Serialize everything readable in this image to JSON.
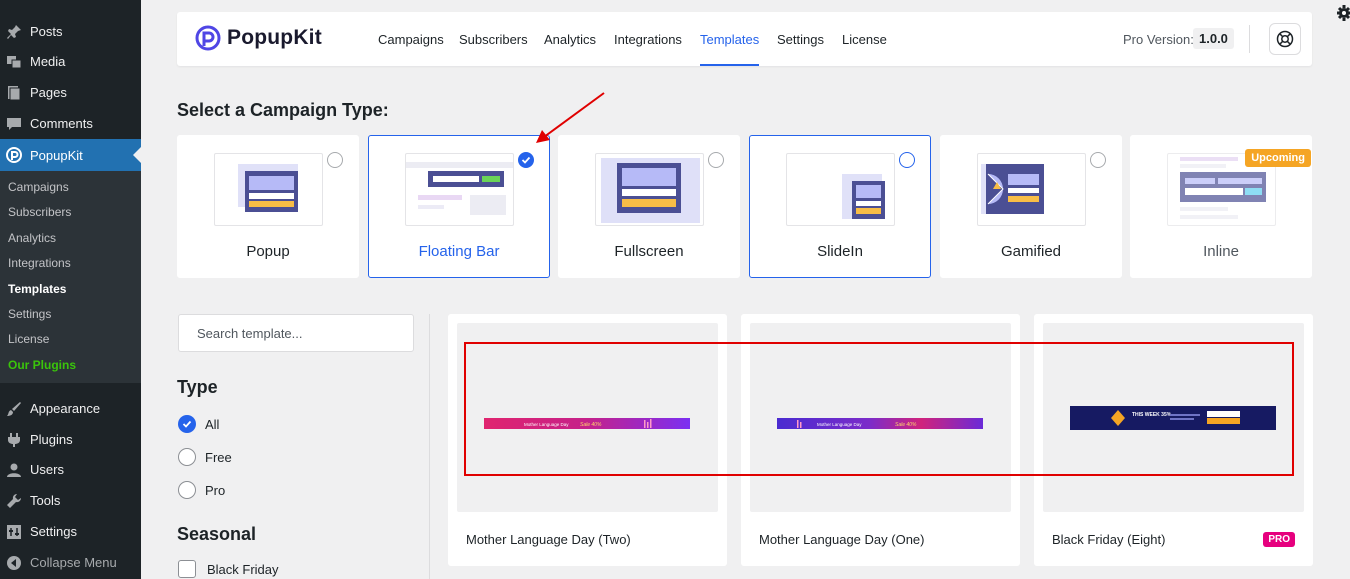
{
  "sidebar": {
    "items": [
      {
        "label": "Posts",
        "icon": "pin-icon"
      },
      {
        "label": "Media",
        "icon": "media-icon"
      },
      {
        "label": "Pages",
        "icon": "pages-icon"
      },
      {
        "label": "Comments",
        "icon": "comments-icon"
      },
      {
        "label": "PopupKit",
        "icon": "popupkit-icon"
      }
    ],
    "submenu": [
      "Campaigns",
      "Subscribers",
      "Analytics",
      "Integrations",
      "Templates",
      "Settings",
      "License",
      "Our Plugins"
    ],
    "items_bottom": [
      {
        "label": "Appearance",
        "icon": "brush-icon"
      },
      {
        "label": "Plugins",
        "icon": "plugin-icon"
      },
      {
        "label": "Users",
        "icon": "user-icon"
      },
      {
        "label": "Tools",
        "icon": "wrench-icon"
      },
      {
        "label": "Settings",
        "icon": "settings-icon"
      },
      {
        "label": "Collapse Menu",
        "icon": "collapse-icon"
      }
    ]
  },
  "header": {
    "brand": "PopupKit",
    "nav": [
      "Campaigns",
      "Subscribers",
      "Analytics",
      "Integrations",
      "Templates",
      "Settings",
      "License"
    ],
    "active_nav": "Templates",
    "pro_label": "Pro Version:",
    "pro_version": "1.0.0"
  },
  "campaign": {
    "title": "Select a Campaign Type:",
    "types": [
      {
        "label": "Popup",
        "state": "unselected"
      },
      {
        "label": "Floating Bar",
        "state": "selected"
      },
      {
        "label": "Fullscreen",
        "state": "unselected"
      },
      {
        "label": "SlideIn",
        "state": "outlined"
      },
      {
        "label": "Gamified",
        "state": "unselected"
      },
      {
        "label": "Inline",
        "state": "upcoming",
        "badge": "Upcoming"
      }
    ]
  },
  "filters": {
    "search_placeholder": "Search template...",
    "type_title": "Type",
    "type_options": [
      "All",
      "Free",
      "Pro"
    ],
    "type_selected": "All",
    "seasonal_title": "Seasonal",
    "seasonal_options": [
      "Black Friday"
    ]
  },
  "templates": [
    {
      "name": "Mother Language Day (Two)",
      "pro": false,
      "bar_text": "Mother Language Day",
      "sale": "Sale 40%"
    },
    {
      "name": "Mother Language Day (One)",
      "pro": false,
      "bar_text": "Mother Language Day",
      "sale": "Sale 40%"
    },
    {
      "name": "Black Friday (Eight)",
      "pro": true,
      "badge": "PRO",
      "bar_text": "THIS WEEK 35%"
    }
  ],
  "colors": {
    "accent": "#2563eb",
    "wp_sidebar": "#1d2327",
    "wp_active": "#2271b1",
    "annotation": "#e00000",
    "upcoming": "#f5a524",
    "pro_badge": "#e6007e"
  }
}
